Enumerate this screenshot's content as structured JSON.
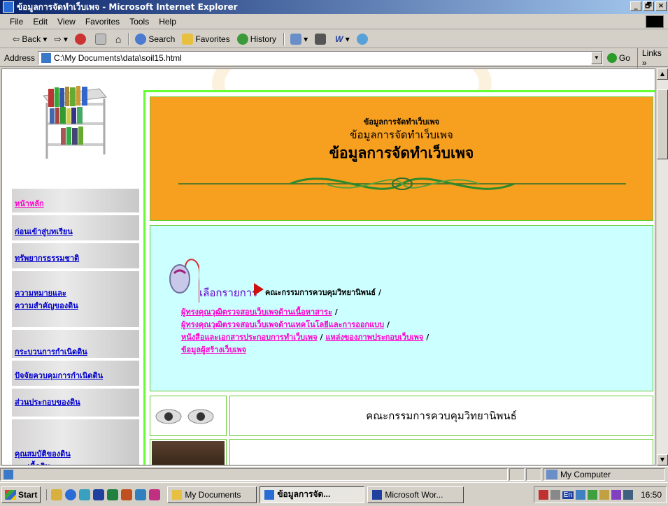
{
  "window": {
    "title": "ข้อมูลการจัดทำเว็บเพจ - Microsoft Internet Explorer",
    "controls": [
      "_",
      "🗗",
      "×"
    ]
  },
  "menubar": [
    "File",
    "Edit",
    "View",
    "Favorites",
    "Tools",
    "Help"
  ],
  "toolbar": {
    "back": "Back",
    "search": "Search",
    "favorites": "Favorites",
    "history": "History"
  },
  "address": {
    "label": "Address",
    "value": "C:\\My Documents\\data\\soil15.html",
    "go": "Go",
    "links": "Links »"
  },
  "sidebar": {
    "items": [
      {
        "label": "หน้าหลัก",
        "active": true
      },
      {
        "label": "ก่อนเข้าสู่บทเรียน",
        "active": false
      },
      {
        "label": "ทรัพยากรธรรมชาติ",
        "active": false
      },
      {
        "label": "ความหมายและ",
        "label2": "ความสำคัญของดิน",
        "active": false
      },
      {
        "label": "กระบวนการกำเนิดดิน",
        "active": false
      },
      {
        "label": "ปัจจัยควบคุมการกำเนิดดิน",
        "active": false
      },
      {
        "label": "ส่วนประกอบของดิน",
        "active": false
      },
      {
        "label": "คุณสมบัติของดิน",
        "label2": "- เนื้อดิน",
        "active": false
      }
    ]
  },
  "header": {
    "line1": "ข้อมูลการจัดทำเว็บเพจ",
    "line2": "ข้อมูลการจัดทำเว็บเพจ",
    "line3": "ข้อมูลการจัดทำเว็บเพจ"
  },
  "menu": {
    "pick_label": "เลือกรายการ",
    "current": "คณะกรรมการควบคุมวิทยานิพนธ์ /",
    "links": [
      {
        "text": "ผู้ทรงคุณวุฒิตรวจสอบเว็บเพจด้านเนื้อหาสาระ",
        "suffix": " /"
      },
      {
        "text": "ผู้ทรงคุณวุฒิตรวจสอบเว็บเพจด้านเทคโนโลยีและการออกแบบ",
        "suffix": " /"
      },
      {
        "text": "หนังสือและเอกสารประกอบการทำเว็บเพจ",
        "suffix": " / ",
        "text2": "แหล่งของภาพประกอบเว็บเพจ",
        "suffix2": " /"
      },
      {
        "text": "ข้อมูลผู้สร้างเว็บเพจ",
        "suffix": ""
      }
    ]
  },
  "section": {
    "title": "คณะกรรมการควบคุมวิทยานิพนธ์"
  },
  "statusbar": {
    "zone": "My Computer"
  },
  "taskbar": {
    "start": "Start",
    "tasks": [
      {
        "label": "My Documents",
        "active": false
      },
      {
        "label": "ข้อมูลการจัด...",
        "active": true
      },
      {
        "label": "Microsoft Wor...",
        "active": false
      }
    ],
    "tray_lang": "En",
    "clock": "16:50"
  }
}
